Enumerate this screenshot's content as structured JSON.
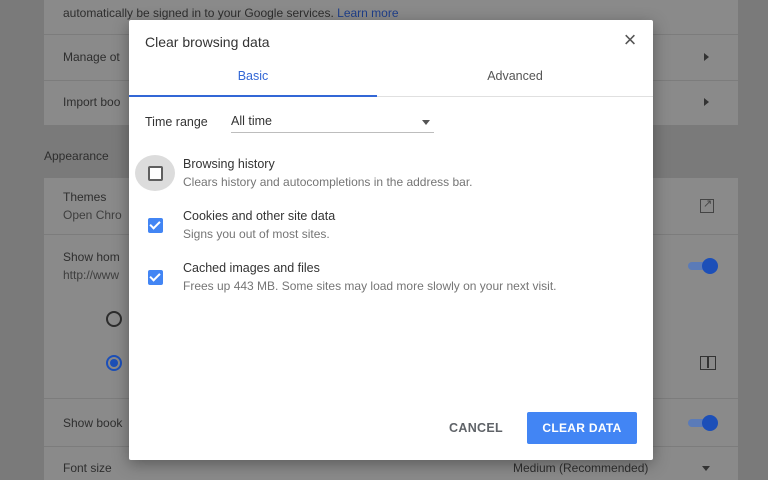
{
  "background": {
    "sync_text": "automatically be signed in to your Google services.",
    "learn_more": "Learn more",
    "manage_other": "Manage ot",
    "import_bookmarks": "Import boo",
    "appearance": "Appearance",
    "themes": "Themes",
    "themes_sub": "Open Chro",
    "show_home": "Show hom",
    "show_home_sub": "http://www",
    "show_bookmarks": "Show book",
    "font_size": "Font size",
    "font_size_value": "Medium (Recommended)"
  },
  "dialog": {
    "title": "Clear browsing data",
    "close_icon": "close-icon",
    "tabs": [
      {
        "label": "Basic",
        "active": true
      },
      {
        "label": "Advanced",
        "active": false
      }
    ],
    "time_range_label": "Time range",
    "time_range_value": "All time",
    "options": [
      {
        "title": "Browsing history",
        "desc": "Clears history and autocompletions in the address bar.",
        "checked": false
      },
      {
        "title": "Cookies and other site data",
        "desc": "Signs you out of most sites.",
        "checked": true
      },
      {
        "title": "Cached images and files",
        "desc": "Frees up 443 MB. Some sites may load more slowly on your next visit.",
        "checked": true
      }
    ],
    "cancel_label": "CANCEL",
    "clear_label": "CLEAR DATA"
  },
  "colors": {
    "accent": "#4285f4",
    "tab_active": "#3367d6"
  }
}
